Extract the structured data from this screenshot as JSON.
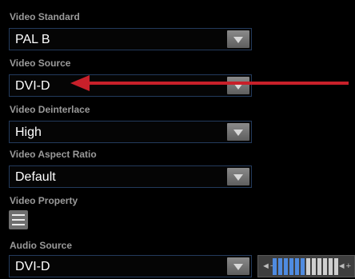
{
  "video_standard": {
    "label": "Video Standard",
    "value": "PAL B"
  },
  "video_source": {
    "label": "Video Source",
    "value": "DVI-D"
  },
  "video_deinterlace": {
    "label": "Video Deinterlace",
    "value": "High"
  },
  "video_aspect_ratio": {
    "label": "Video Aspect Ratio",
    "value": "Default"
  },
  "video_property": {
    "label": "Video Property",
    "icon": "menu-icon"
  },
  "audio_source": {
    "label": "Audio Source",
    "value": "DVI-D"
  },
  "volume": {
    "minus_label": "◄−",
    "plus_label": "◄+",
    "level": 0.5
  },
  "annotation": {
    "arrow_color": "#c8202a"
  },
  "colors": {
    "background": "#000000",
    "label": "#9a9a9a",
    "field_border": "#233a5c",
    "dropdown_button": "#6f6f6f",
    "volume_active": "#4f8be0"
  }
}
